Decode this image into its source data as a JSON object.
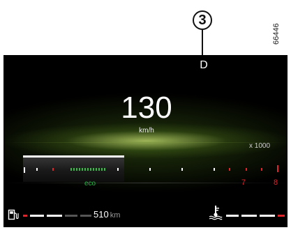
{
  "figure": {
    "callout_number": "3",
    "reference_code": "66446"
  },
  "cluster": {
    "gear": "D",
    "speed": "130",
    "speed_unit": "km/h",
    "rpm_scale_label": "x 1000",
    "rpm_marks": [
      "7",
      "8"
    ],
    "eco_label": "eco",
    "range_value": "510",
    "range_unit": "km"
  },
  "colors": {
    "eco": "#29b84a",
    "redline": "#e0242a",
    "text": "#ffffff",
    "panel": "#000000"
  },
  "icons": {
    "fuel": "fuel-pump-icon",
    "coolant": "coolant-temperature-icon"
  }
}
